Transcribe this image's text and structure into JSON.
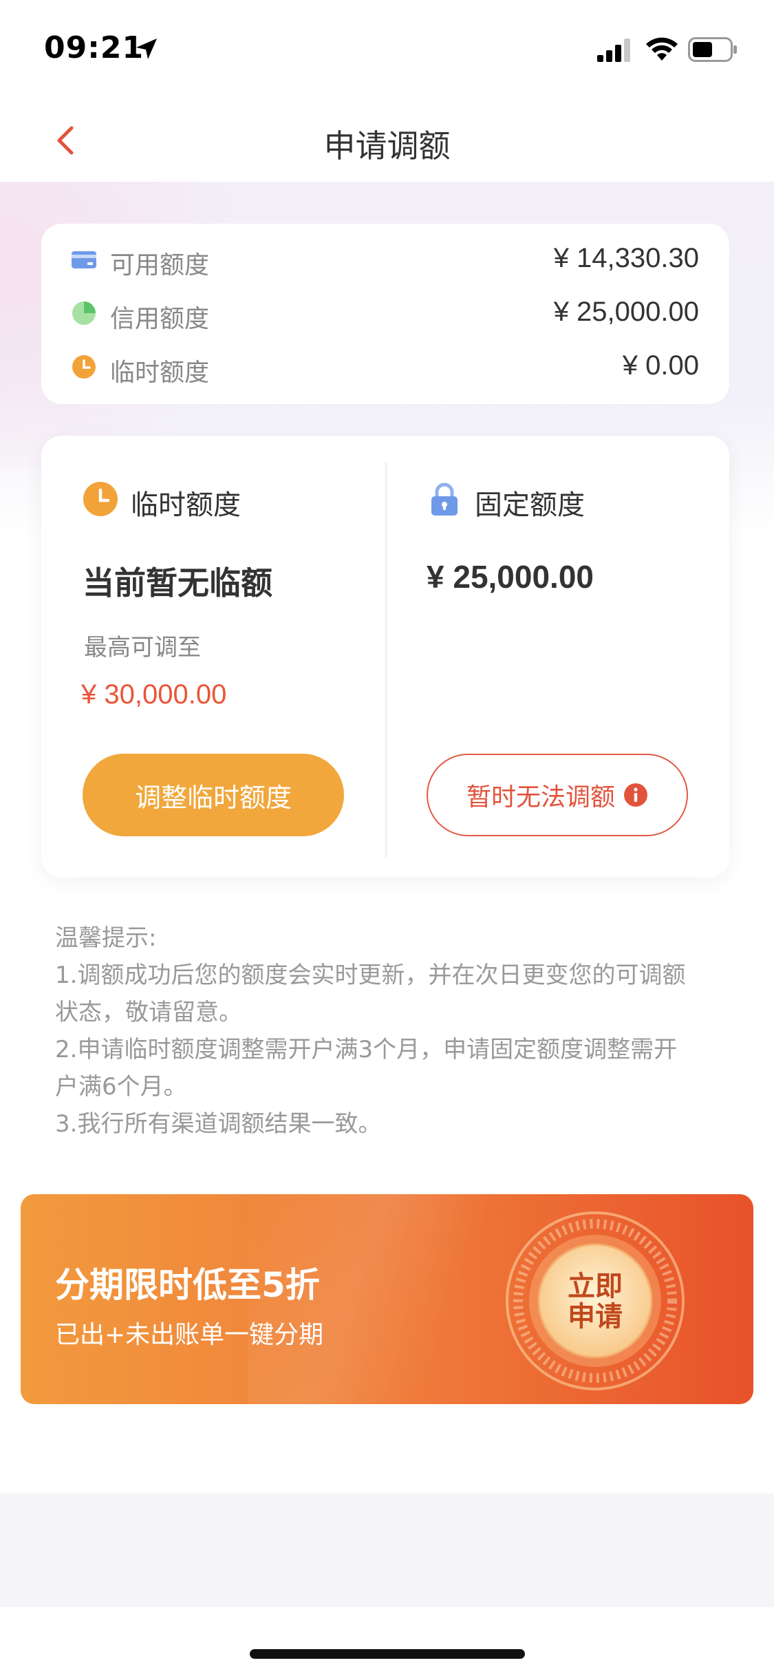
{
  "status_bar": {
    "time": "09:21"
  },
  "nav": {
    "title": "申请调额"
  },
  "summary": {
    "rows": [
      {
        "label": "可用额度",
        "value": "¥ 14,330.30",
        "icon": "card-icon"
      },
      {
        "label": "信用额度",
        "value": "¥ 25,000.00",
        "icon": "pie-icon"
      },
      {
        "label": "临时额度",
        "value": "¥ 0.00",
        "icon": "clock-icon"
      }
    ]
  },
  "temp_limit": {
    "title": "临时额度",
    "status": "当前暂无临额",
    "max_label": "最高可调至",
    "max_value": "¥ 30,000.00",
    "button": "调整临时额度"
  },
  "fixed_limit": {
    "title": "固定额度",
    "value": "¥ 25,000.00",
    "button": "暂时无法调额"
  },
  "tips": {
    "title": "温馨提示:",
    "lines": [
      "1.调额成功后您的额度会实时更新，并在次日更变您的可调额",
      "状态，敬请留意。",
      "2.申请临时额度调整需开户满3个月，申请固定额度调整需开",
      "户满6个月。",
      "3.我行所有渠道调额结果一致。"
    ]
  },
  "banner": {
    "title": "分期限时低至5折",
    "subtitle": "已出+未出账单一键分期",
    "badge_line1": "立即",
    "badge_line2": "申请"
  },
  "colors": {
    "accent_orange": "#f1a73c",
    "accent_red": "#e95637",
    "text_dark": "#333333",
    "text_gray": "#888888"
  }
}
